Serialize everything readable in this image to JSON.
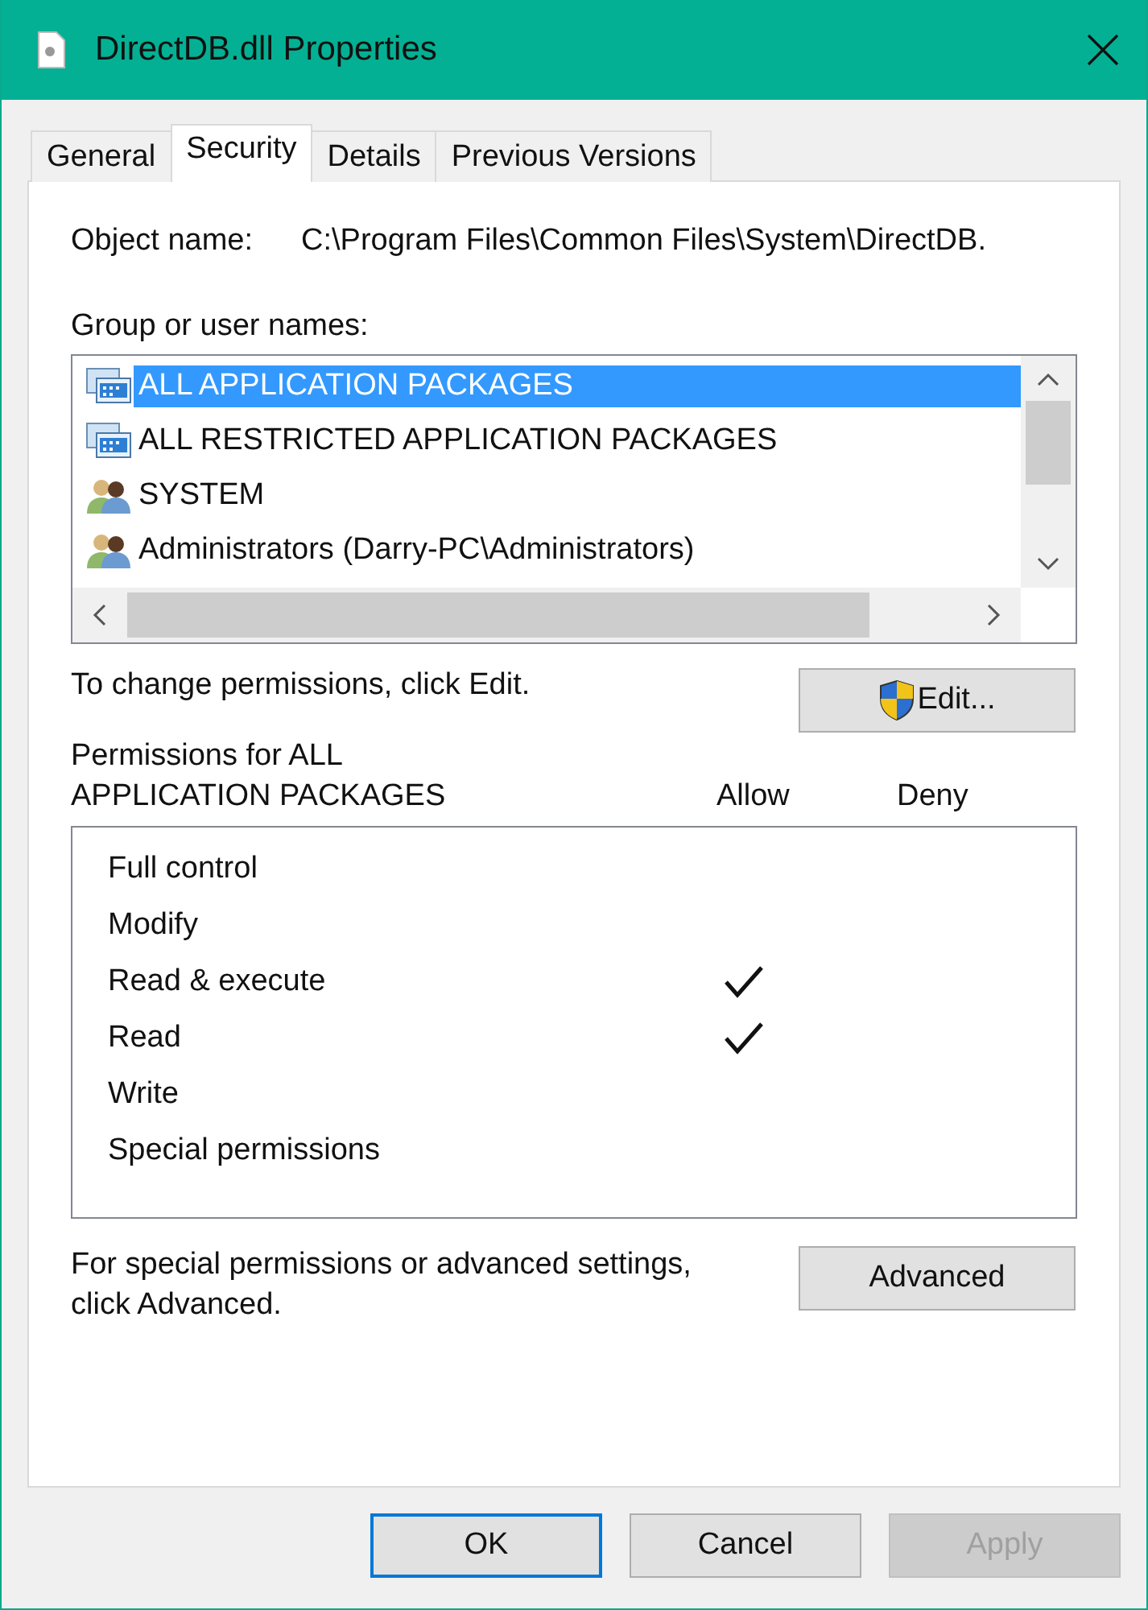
{
  "window": {
    "title": "DirectDB.dll Properties"
  },
  "tabs": [
    {
      "label": "General",
      "selected": false
    },
    {
      "label": "Security",
      "selected": true
    },
    {
      "label": "Details",
      "selected": false
    },
    {
      "label": "Previous Versions",
      "selected": false
    }
  ],
  "object_name": {
    "label": "Object name:",
    "value": "C:\\Program Files\\Common Files\\System\\DirectDB."
  },
  "groups": {
    "label": "Group or user names:",
    "items": [
      {
        "name": "ALL APPLICATION PACKAGES",
        "kind": "package",
        "selected": true
      },
      {
        "name": "ALL RESTRICTED APPLICATION PACKAGES",
        "kind": "package",
        "selected": false
      },
      {
        "name": "SYSTEM",
        "kind": "users",
        "selected": false
      },
      {
        "name": "Administrators (Darry-PC\\Administrators)",
        "kind": "users",
        "selected": false
      }
    ]
  },
  "change_hint": "To change permissions, click Edit.",
  "edit_button": "Edit...",
  "permissions": {
    "title_line_1": "Permissions for ALL",
    "title_line_2": "APPLICATION PACKAGES",
    "allow_header": "Allow",
    "deny_header": "Deny",
    "rows": [
      {
        "name": "Full control",
        "allow": false,
        "deny": false
      },
      {
        "name": "Modify",
        "allow": false,
        "deny": false
      },
      {
        "name": "Read & execute",
        "allow": true,
        "deny": false
      },
      {
        "name": "Read",
        "allow": true,
        "deny": false
      },
      {
        "name": "Write",
        "allow": false,
        "deny": false
      },
      {
        "name": "Special permissions",
        "allow": false,
        "deny": false
      }
    ]
  },
  "advanced_hint": {
    "line_1": "For special permissions or advanced settings,",
    "line_2": "click Advanced."
  },
  "advanced_button": "Advanced",
  "buttons": [
    {
      "label": "OK",
      "kind": "default",
      "disabled": false
    },
    {
      "label": "Cancel",
      "kind": "normal",
      "disabled": false
    },
    {
      "label": "Apply",
      "kind": "normal",
      "disabled": true
    }
  ]
}
